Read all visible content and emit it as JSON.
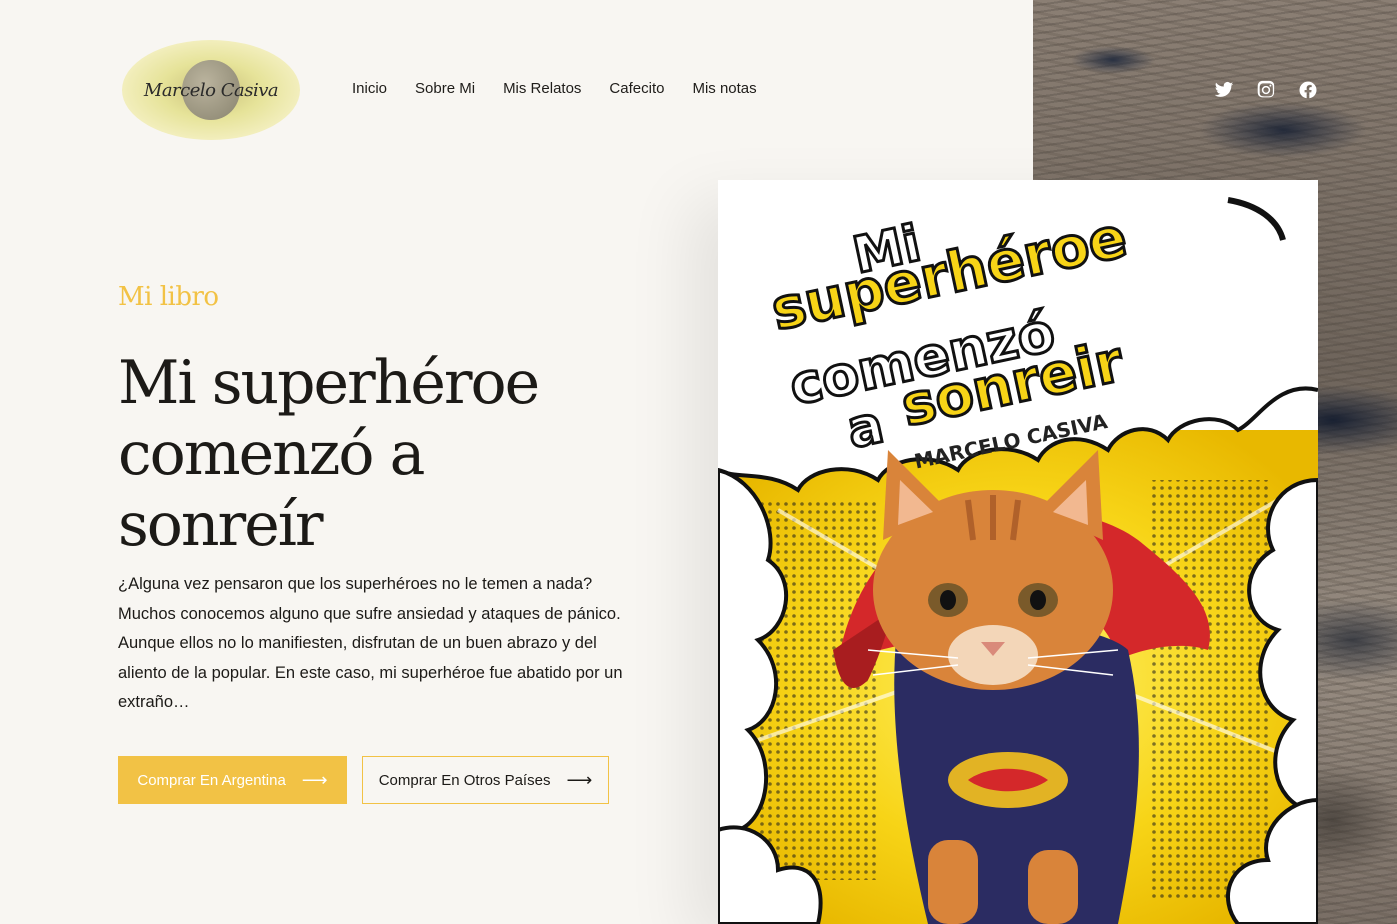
{
  "brand": {
    "logo_text": "Marcelo Casiva"
  },
  "nav": {
    "items": [
      {
        "label": "Inicio"
      },
      {
        "label": "Sobre Mi"
      },
      {
        "label": "Mis Relatos"
      },
      {
        "label": "Cafecito"
      },
      {
        "label": "Mis notas"
      }
    ]
  },
  "social": {
    "icons": [
      "twitter-icon",
      "instagram-icon",
      "facebook-icon"
    ]
  },
  "hero": {
    "kicker": "Mi libro",
    "title_line1": "Mi superhéroe",
    "title_line2": "comenzó a",
    "title_line3": "sonreír",
    "description": "¿Alguna vez pensaron que los superhéroes no le temen a nada? Muchos conocemos alguno que sufre ansiedad y ataques de pánico. Aunque ellos no lo manifiesten, disfrutan de un buen abrazo y del aliento de la popular. En este caso, mi superhéroe fue abatido por un extraño…",
    "buy_argentina": "Comprar En Argentina",
    "buy_other": "Comprar En Otros Países",
    "arrow": "⟶"
  },
  "cover": {
    "line1": "Mi",
    "line2": "superhéroe",
    "line3": "comenzó",
    "line4_a": "a",
    "line4_b": "sonreir",
    "author": "MARCELO CASIVA"
  },
  "colors": {
    "accent": "#f2c245",
    "background": "#f8f6f2",
    "text": "#1c1a17",
    "cover_yellow": "#f7d417",
    "cape_red": "#d4282a",
    "cat_orange": "#d9843a"
  }
}
